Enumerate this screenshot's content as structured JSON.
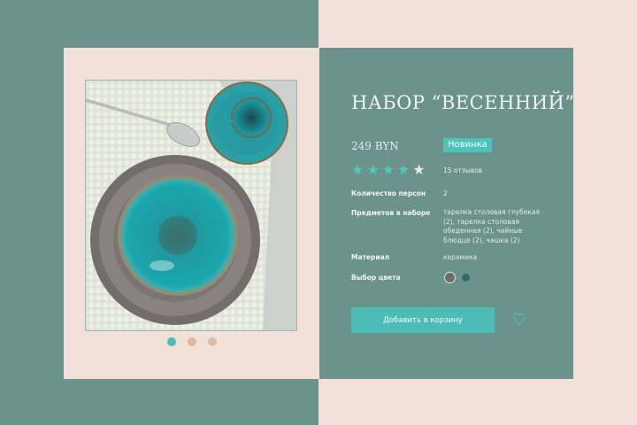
{
  "product": {
    "title": "НАБОР “ВЕСЕННИЙ”",
    "price": "249 BYN",
    "badge": "Новинка",
    "rating": {
      "filled": 4,
      "total": 5
    },
    "reviews": "15 отзывов",
    "specs": [
      {
        "label": "Количество персон",
        "value": "2"
      },
      {
        "label": "Предметов в наборе",
        "value": "тарелка столовая глубокая (2), тарелка столовая обеденная (2), чайные блюдце (2), чашка (2)"
      },
      {
        "label": "Материал",
        "value": "керамика"
      },
      {
        "label": "Выбор цвета",
        "value": ""
      }
    ],
    "color_options": [
      "#6c6c6c",
      "#2d6e6e"
    ],
    "add_to_cart_label": "Добавить в корзину",
    "image_icon": "tableware-set-photo",
    "favorite_icon": "heart-icon"
  },
  "carousel": {
    "count": 3,
    "active_index": 0
  },
  "colors": {
    "teal_bg": "#6b928b",
    "peach_bg": "#f1e1d8",
    "accent": "#4ebcb6",
    "dot_inactive": "#dfb9a3"
  }
}
